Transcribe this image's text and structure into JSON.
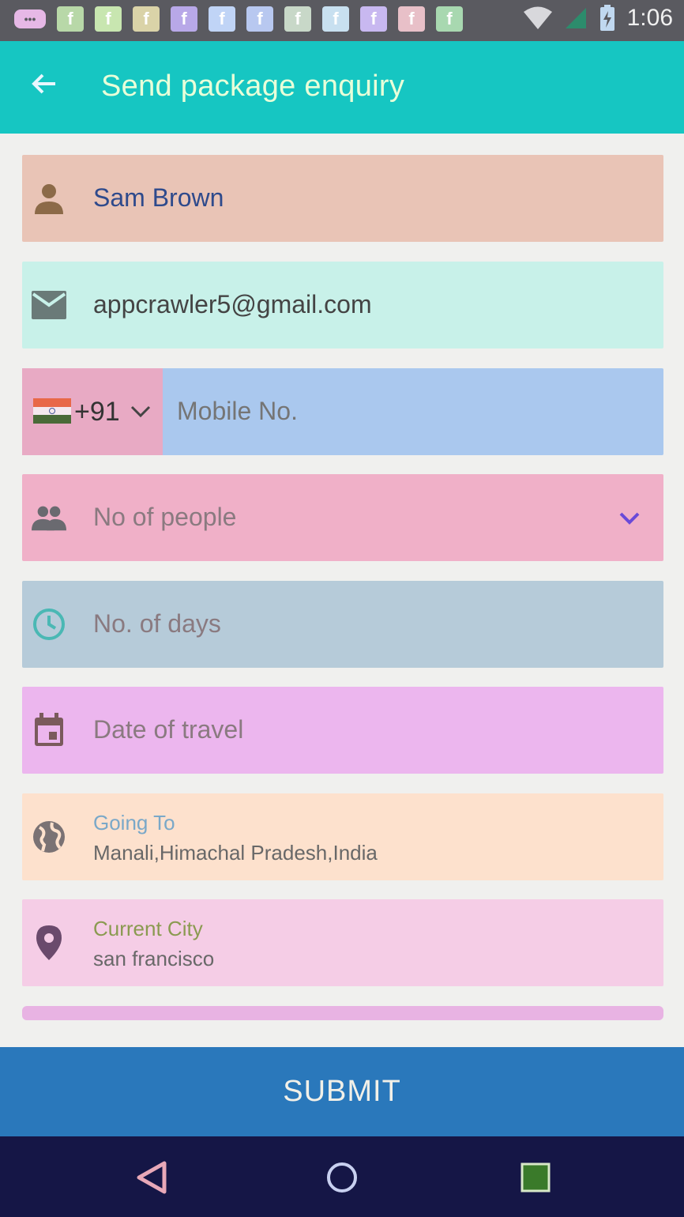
{
  "status_bar": {
    "time": "1:06",
    "notification_icons": [
      "message-icon",
      "facebook-icon",
      "facebook-icon",
      "facebook-icon",
      "facebook-icon",
      "facebook-icon",
      "facebook-icon",
      "facebook-icon",
      "facebook-icon",
      "facebook-icon",
      "facebook-icon",
      "facebook-icon"
    ],
    "notification_colors": [
      "#e6b8e6",
      "#b8d8a8",
      "#c8e6b0",
      "#dad3a8",
      "#b8a8e8",
      "#c0d4f6",
      "#b8c8f0",
      "#c8d8c8",
      "#c8e0f0",
      "#c8b8f0",
      "#e8c0c8",
      "#a8d8b0"
    ]
  },
  "app_bar": {
    "title": "Send package enquiry",
    "back_icon": "arrow-back-icon"
  },
  "form": {
    "name": {
      "icon": "person-icon",
      "value": "Sam Brown"
    },
    "email": {
      "icon": "email-icon",
      "value": "appcrawler5@gmail.com"
    },
    "mobile": {
      "country_code": "+91",
      "flag": "india-flag",
      "placeholder": "Mobile No."
    },
    "people": {
      "icon": "group-icon",
      "placeholder": "No of people",
      "dropdown_icon": "chevron-down-icon"
    },
    "days": {
      "icon": "clock-icon",
      "placeholder": "No. of days"
    },
    "date": {
      "icon": "calendar-icon",
      "placeholder": "Date of travel"
    },
    "going_to": {
      "icon": "globe-icon",
      "label": "Going To",
      "value": "Manali,Himachal Pradesh,India"
    },
    "current_city": {
      "icon": "location-pin-icon",
      "label": "Current City",
      "value": "san francisco"
    }
  },
  "submit": {
    "label": "SUBMIT"
  },
  "nav_bar": {
    "back": "nav-back-icon",
    "home": "nav-home-icon",
    "recents": "nav-recents-icon"
  },
  "colors": {
    "app_bar": "#16c6c2",
    "submit": "#2a78bb",
    "nav_bar": "#151646"
  }
}
